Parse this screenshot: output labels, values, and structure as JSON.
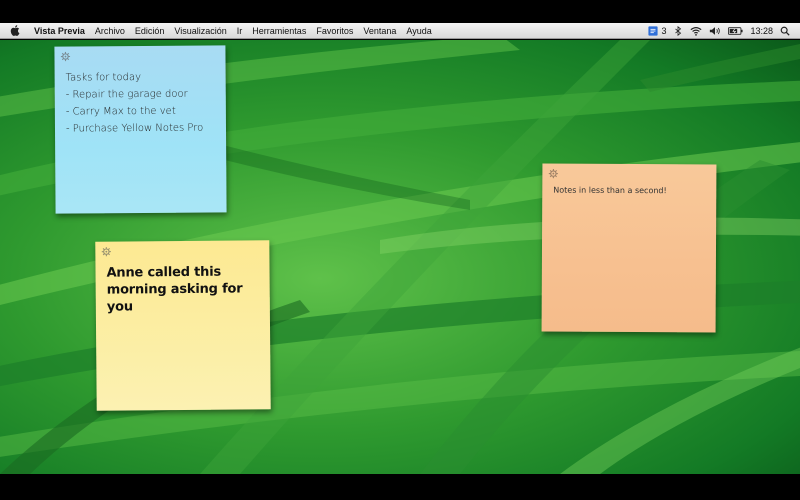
{
  "menubar": {
    "app_name": "Vista Previa",
    "items": [
      "Archivo",
      "Edición",
      "Visualización",
      "Ir",
      "Herramientas",
      "Favoritos",
      "Ventana",
      "Ayuda"
    ],
    "status": {
      "notes_count": "3",
      "clock": "13:28"
    }
  },
  "notes": {
    "blue": {
      "color": "#a5e0f5",
      "lines": [
        "Tasks for today",
        "- Repair the garage door",
        "- Carry Max to the vet",
        "- Purchase Yellow Notes Pro"
      ]
    },
    "yellow": {
      "color": "#fbeca2",
      "text": "Anne called this morning asking for you"
    },
    "orange": {
      "color": "#f7c493",
      "text": "Notes in less than a second!"
    }
  }
}
